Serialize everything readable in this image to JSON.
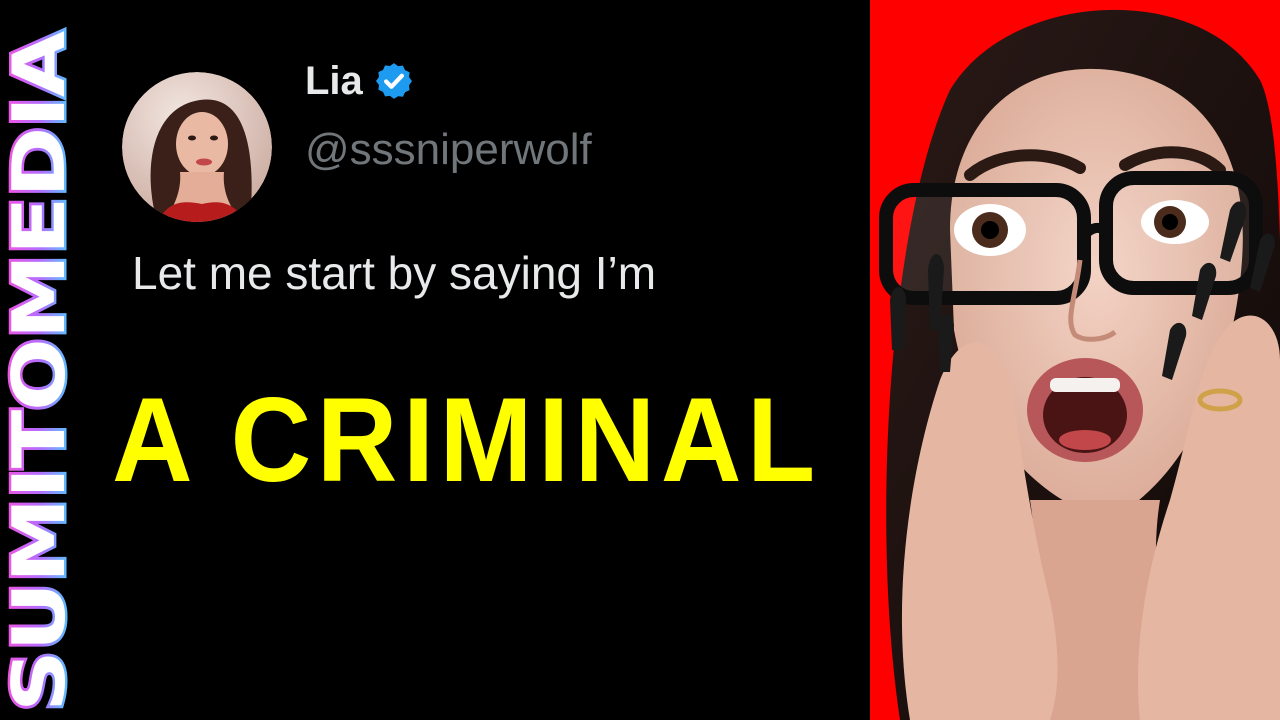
{
  "brand": {
    "part1": "SUMITO",
    "part2": "MEDIA",
    "color_top": "#ff4fd8",
    "color_bottom": "#33e6ff",
    "fill": "#ffffff"
  },
  "tweet": {
    "display_name": "Lia",
    "verified": true,
    "verified_color": "#1d9bf0",
    "handle": "@sssniperwolf",
    "text": "Let me start by saying I’m"
  },
  "headline": {
    "text": "A CRIMINAL",
    "color": "#ffff00"
  },
  "reaction_photo": {
    "background_color": "#ff0000",
    "subject": "shocked-woman-with-glasses"
  }
}
